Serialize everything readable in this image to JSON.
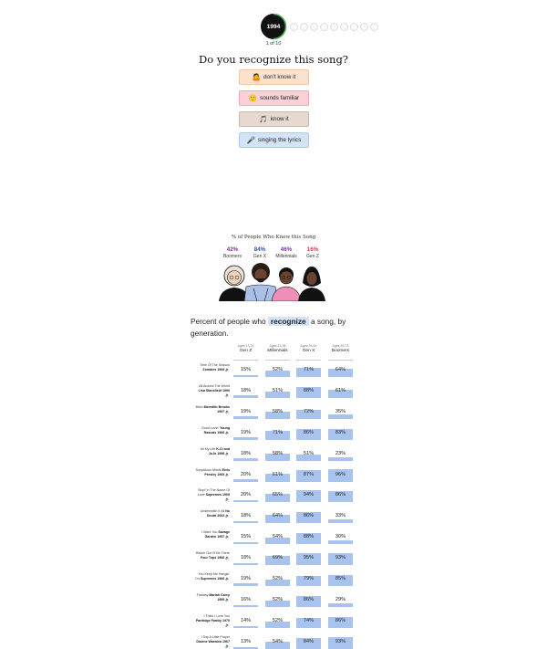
{
  "quiz": {
    "year": "1994",
    "counter": "1 of 10",
    "dot_count": 9,
    "question": "Do you recognize this song?",
    "answers": [
      {
        "emoji": "🤷",
        "label": "don't know it",
        "color": "#fbe2d0"
      },
      {
        "emoji": "🙂",
        "label": "sounds familiar",
        "color": "#f9d1d6"
      },
      {
        "emoji": "🎵",
        "label": "know it",
        "color": "#e7d9cf"
      },
      {
        "emoji": "🎤",
        "label": "singing the lyrics",
        "color": "#d3e3f8"
      }
    ]
  },
  "summary": {
    "title": "% of People Who Know this Song",
    "stats": [
      {
        "pct": "42%",
        "name": "Boomers",
        "color": "#7b2fa3"
      },
      {
        "pct": "84%",
        "name": "Gen X",
        "color": "#3347b8"
      },
      {
        "pct": "46%",
        "name": "Millennials",
        "color": "#7b2fa3"
      },
      {
        "pct": "16%",
        "name": "Gen Z",
        "color": "#d03a4a"
      }
    ]
  },
  "intro": {
    "before": "Percent of people who",
    "highlight": "recognize",
    "after": "a song, by generation."
  },
  "table": {
    "bar_color": "#a8c4ee",
    "columns": [
      {
        "ages": "Ages 13-22",
        "name": "Gen Z"
      },
      {
        "ages": "Ages 23-38",
        "name": "Millennials"
      },
      {
        "ages": "Ages 39-54",
        "name": "Gen X"
      },
      {
        "ages": "Ages 55-73",
        "name": "Boomers"
      }
    ],
    "rows": [
      {
        "title": "Time Of The Season",
        "artist": "Zombies",
        "year": "1969",
        "values": [
          15,
          52,
          71,
          64
        ]
      },
      {
        "title": "All Around The World",
        "artist": "Lisa Stansfield",
        "year": "1990",
        "values": [
          18,
          51,
          88,
          61
        ]
      },
      {
        "title": "Bitch",
        "artist": "Meredith Brooks",
        "year": "1997",
        "values": [
          19,
          58,
          72,
          35
        ]
      },
      {
        "title": "Good Lovin'",
        "artist": "Young Rascals",
        "year": "1966",
        "values": [
          19,
          71,
          86,
          83
        ]
      },
      {
        "title": "All My Life",
        "artist": "K-Ci and JoJo",
        "year": "1998",
        "values": [
          18,
          58,
          51,
          23
        ]
      },
      {
        "title": "Suspicious Minds",
        "artist": "Elvis Presley",
        "year": "1969",
        "values": [
          20,
          61,
          87,
          96
        ]
      },
      {
        "title": "Stop! In The Name Of Love",
        "artist": "Supremes",
        "year": "1965",
        "values": [
          20,
          65,
          94,
          86
        ]
      },
      {
        "title": "Underneath It All",
        "artist": "No Doubt",
        "year": "2002",
        "values": [
          18,
          64,
          86,
          33
        ]
      },
      {
        "title": "I Want You",
        "artist": "Savage Garden",
        "year": "1997",
        "values": [
          15,
          54,
          88,
          30
        ]
      },
      {
        "title": "Reach Out I'll Be There",
        "artist": "Four Tops",
        "year": "1966",
        "values": [
          18,
          69,
          95,
          93
        ]
      },
      {
        "title": "You Keep Me Hangin' On",
        "artist": "Supremes",
        "year": "1966",
        "values": [
          19,
          52,
          79,
          85
        ]
      },
      {
        "title": "Fantasy",
        "artist": "Mariah Carey",
        "year": "1995",
        "values": [
          16,
          52,
          86,
          29
        ]
      },
      {
        "title": "I Think I Love You",
        "artist": "Partridge Family",
        "year": "1970",
        "values": [
          14,
          52,
          74,
          86
        ]
      },
      {
        "title": "I Say A Little Prayer",
        "artist": "Dionne Warwick",
        "year": "1967",
        "values": [
          13,
          54,
          84,
          93
        ]
      }
    ]
  }
}
